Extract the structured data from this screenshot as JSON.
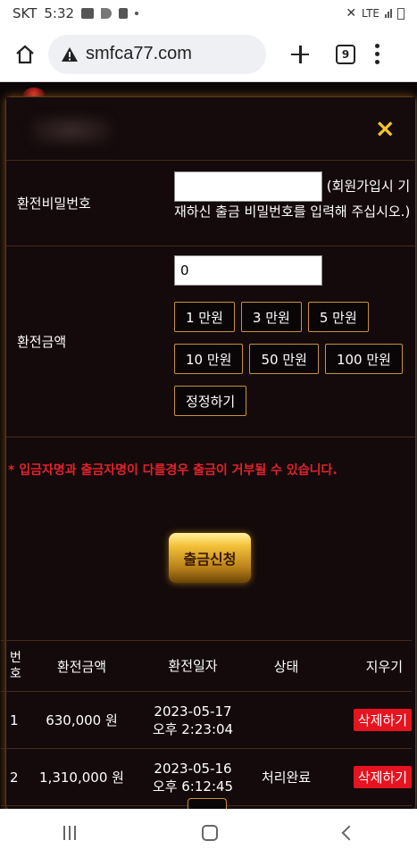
{
  "status_bar": {
    "carrier": "SKT",
    "time": "5:32",
    "network": "LTE"
  },
  "browser": {
    "url": "smfca77.com",
    "tab_count": "9"
  },
  "modal": {
    "close_label": "×"
  },
  "form": {
    "password_label": "환전비밀번호",
    "password_value": "",
    "password_hint": "(회원가입시 기재하신 출금 비밀번호를 입력해 주십시오.)",
    "amount_label": "환전금액",
    "amount_value": "0",
    "amount_buttons_row1": [
      "1 만원",
      "3 만원",
      "5 만원"
    ],
    "amount_buttons_row2": [
      "10 만원",
      "50 만원",
      "100 만원"
    ],
    "reset_label": "정정하기"
  },
  "notice": "* 입금자명과 출금자명이 다를경우 출금이 거부될 수 있습니다.",
  "submit_label": "출금신청",
  "table": {
    "headers": {
      "no": "번호",
      "amount": "환전금액",
      "date": "환전일자",
      "status": "상태",
      "delete": "지우기"
    },
    "rows": [
      {
        "no": "1",
        "amount": "630,000 원",
        "date": "2023-05-17",
        "time": "오후 2:23:04",
        "status": "",
        "delete": "삭제하기"
      },
      {
        "no": "2",
        "amount": "1,310,000 원",
        "date": "2023-05-16",
        "time": "오후 6:12:45",
        "status": "처리완료",
        "delete": "삭제하기"
      }
    ]
  },
  "colors": {
    "accent_gold": "#f2c230",
    "notice_red": "#e0232d",
    "delete_red": "#e51420",
    "border_gold": "#c8923a"
  }
}
